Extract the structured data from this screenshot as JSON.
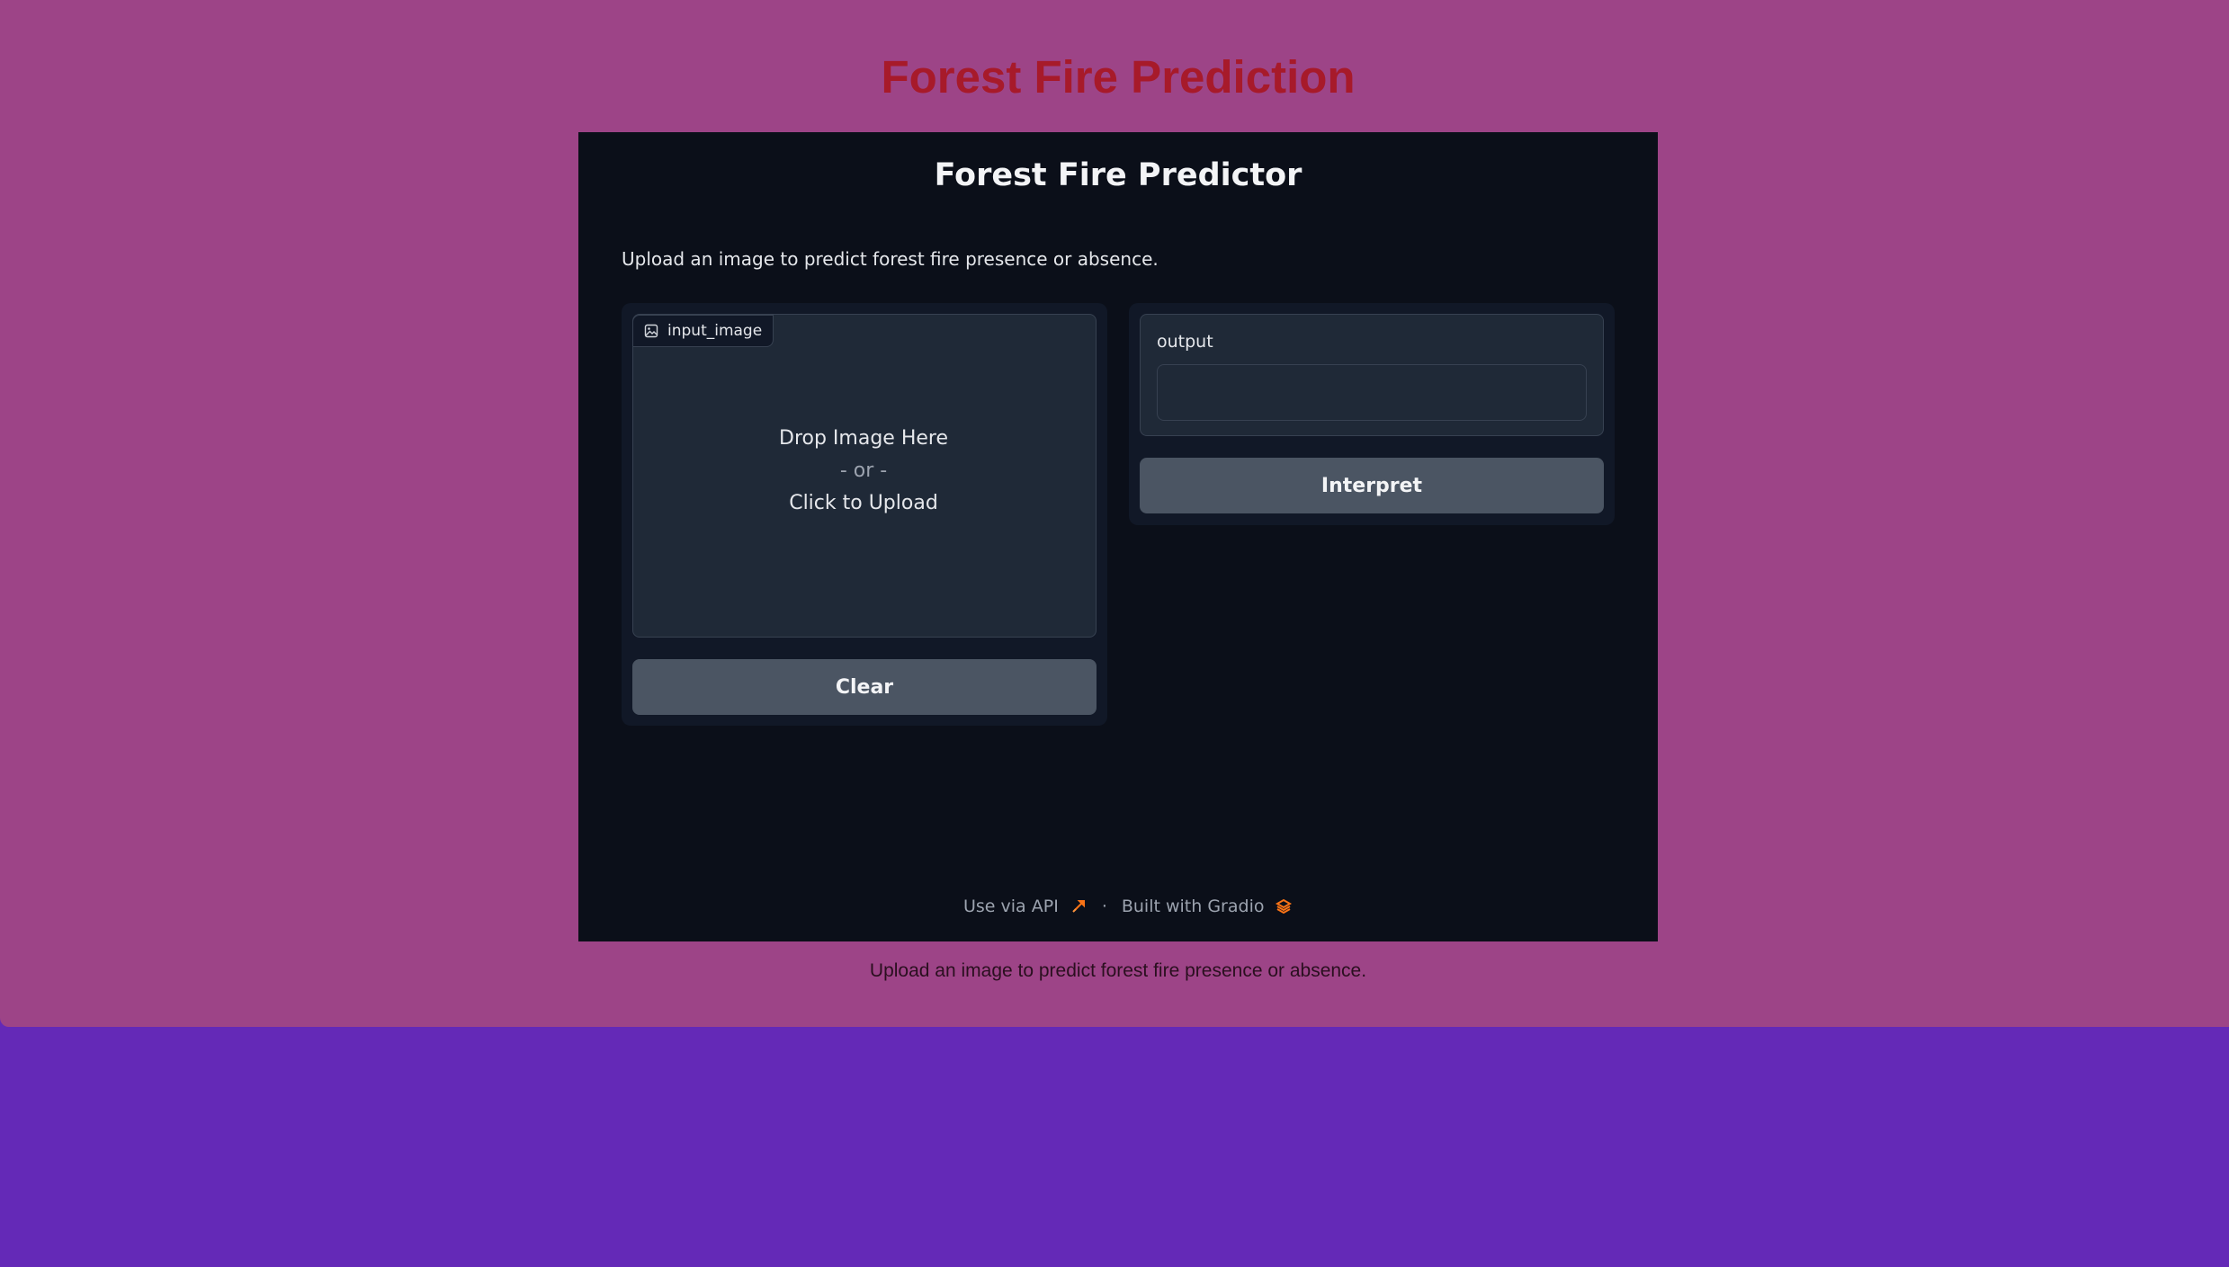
{
  "page": {
    "title": "Forest Fire Prediction",
    "footer_text": "Upload an image to predict forest fire presence or absence."
  },
  "app": {
    "title": "Forest Fire Predictor",
    "description": "Upload an image to predict forest fire presence or absence.",
    "input": {
      "label": "input_image",
      "label_icon": "image-icon",
      "drop_text": "Drop Image Here",
      "or_text": "- or -",
      "click_text": "Click to Upload"
    },
    "clear_button": "Clear",
    "output": {
      "label": "output",
      "value": ""
    },
    "interpret_button": "Interpret",
    "footer": {
      "api_link": "Use via API",
      "api_icon": "rocket-icon",
      "separator": "·",
      "built_with": "Built with Gradio",
      "gradio_icon": "gradio-logo-icon"
    }
  },
  "colors": {
    "page_background": "#9d4487",
    "outer_background": "#6429b7",
    "title_color": "#a71a2a",
    "app_background": "#0b0f19",
    "accent_orange": "#f97316"
  }
}
